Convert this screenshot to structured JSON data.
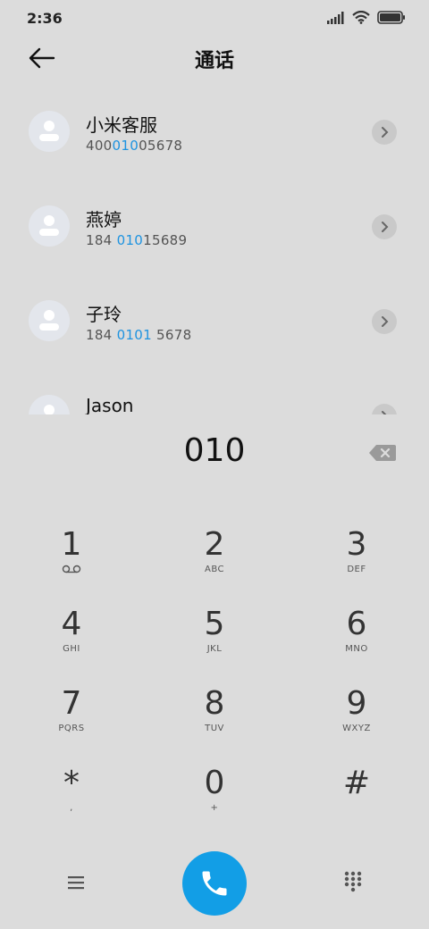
{
  "status": {
    "time": "2:36"
  },
  "header": {
    "title": "通话"
  },
  "contacts": [
    {
      "name": "小米客服",
      "num_pre": "400",
      "num_hl": "010",
      "num_post": "05678"
    },
    {
      "name": "燕婷",
      "num_pre": "184 ",
      "num_hl": "010",
      "num_post": "15689"
    },
    {
      "name": "子玲",
      "num_pre": "184 ",
      "num_hl": "0101",
      "num_post": " 5678"
    },
    {
      "name": "Jason",
      "num_pre": "",
      "num_hl": "",
      "num_post": ""
    }
  ],
  "dialed": "010",
  "keys": [
    {
      "digit": "1",
      "sub": ""
    },
    {
      "digit": "2",
      "sub": "ABC"
    },
    {
      "digit": "3",
      "sub": "DEF"
    },
    {
      "digit": "4",
      "sub": "GHI"
    },
    {
      "digit": "5",
      "sub": "JKL"
    },
    {
      "digit": "6",
      "sub": "MNO"
    },
    {
      "digit": "7",
      "sub": "PQRS"
    },
    {
      "digit": "8",
      "sub": "TUV"
    },
    {
      "digit": "9",
      "sub": "WXYZ"
    },
    {
      "digit": "*",
      "sub": ","
    },
    {
      "digit": "0",
      "sub": "+"
    },
    {
      "digit": "#",
      "sub": ""
    }
  ],
  "colors": {
    "accent": "#1e93e0",
    "call": "#129ee6",
    "background": "#dcdcdc"
  },
  "icons": [
    "back-arrow-icon",
    "voicemail-icon",
    "delete-icon",
    "menu-icon",
    "phone-icon",
    "dialpad-icon",
    "chevron-right-icon",
    "contact-avatar-icon"
  ]
}
